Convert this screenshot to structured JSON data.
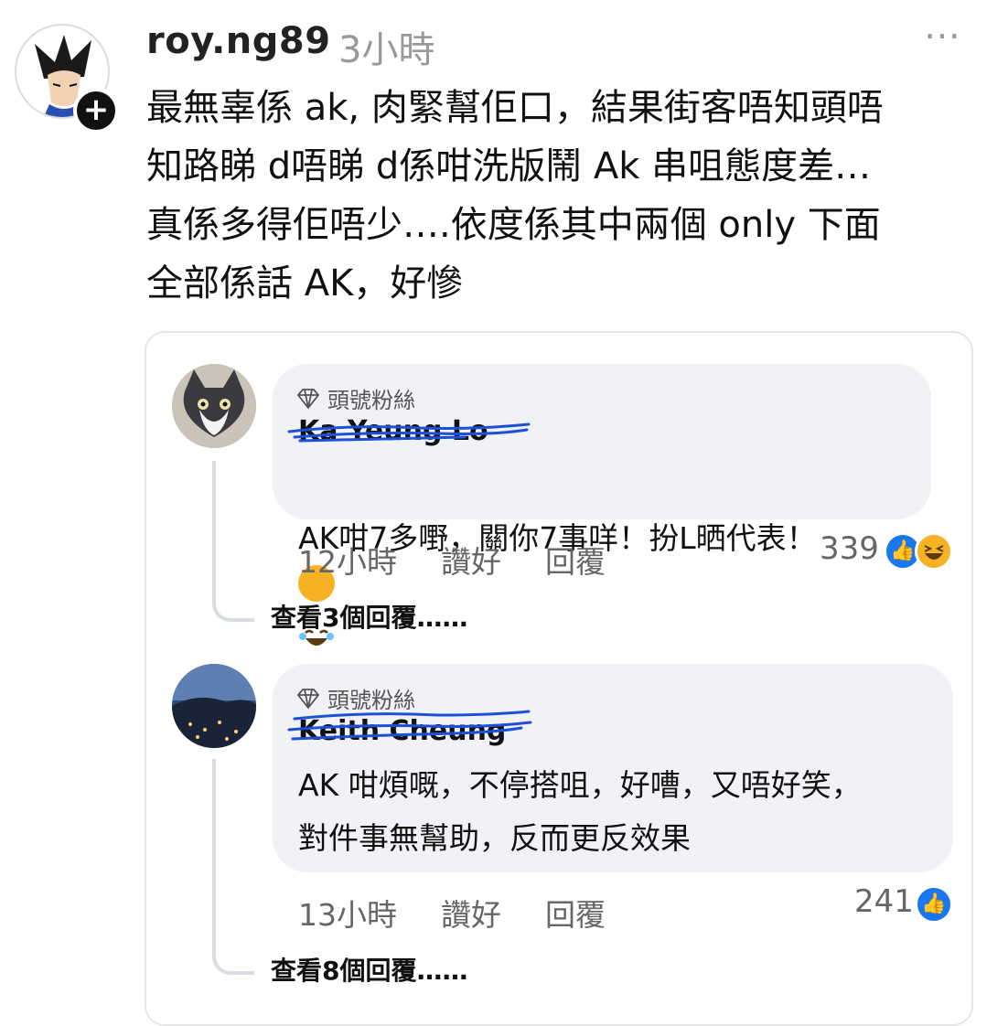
{
  "post": {
    "username": "roy.ng89",
    "time": "3小時",
    "more_icon": "⋯",
    "follow_icon": "+",
    "text": "最無辜係 ak, 肉緊幫佢口，結果街客唔知頭唔\n知路睇 d唔睇 d係咁洗版鬧 Ak 串咀態度差…\n真係多得佢唔少….依度係其中兩個 only 下面\n全部係話 AK，好慘"
  },
  "comments": [
    {
      "badge": "頭號粉絲",
      "name": "Ka Yeung Lo",
      "text": "AK咁7多嘢，關你7事咩！扮L晒代表！",
      "time": "12小時",
      "like_label": "讚好",
      "reply_label": "回覆",
      "reaction_count": "339",
      "reactions": [
        "like-icon",
        "laugh-icon"
      ],
      "view_replies": "查看3個回覆……"
    },
    {
      "badge": "頭號粉絲",
      "name": "Keith Cheung",
      "text": "AK 咁煩嘅，不停搭咀，好嘈，又唔好笑，\n對件事無幫助，反而更反效果",
      "time": "13小時",
      "like_label": "讚好",
      "reply_label": "回覆",
      "reaction_count": "241",
      "reactions": [
        "like-icon"
      ],
      "view_replies": "查看8個回覆……"
    }
  ],
  "colors": {
    "like_blue": "#1877f2",
    "haha_yellow": "#f7b125",
    "bubble_bg": "#f0f2f5",
    "scribble_blue": "#1d4fd8"
  }
}
